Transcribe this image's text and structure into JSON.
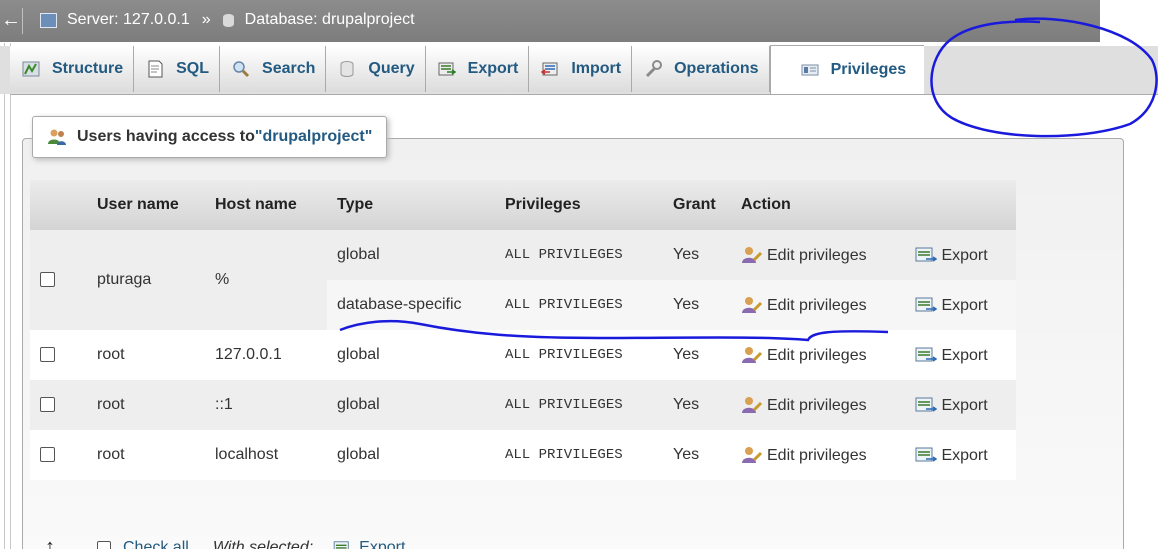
{
  "topbar": {
    "back_glyph": "←",
    "server_label": "Server: 127.0.0.1",
    "separator": "»",
    "database_label": "Database: drupalproject"
  },
  "tabs": [
    {
      "label": "Structure",
      "icon": "structure-icon"
    },
    {
      "label": "SQL",
      "icon": "sql-icon"
    },
    {
      "label": "Search",
      "icon": "search-icon"
    },
    {
      "label": "Query",
      "icon": "query-icon"
    },
    {
      "label": "Export",
      "icon": "export-icon"
    },
    {
      "label": "Import",
      "icon": "import-icon"
    },
    {
      "label": "Operations",
      "icon": "wrench-icon"
    },
    {
      "label": "Privileges",
      "icon": "privileges-icon",
      "active": true
    }
  ],
  "section": {
    "title_prefix": "Users having access to ",
    "title_db": "\"drupalproject\""
  },
  "table": {
    "headers": [
      "User name",
      "Host name",
      "Type",
      "Privileges",
      "Grant",
      "Action"
    ],
    "rows": [
      {
        "user": "pturaga",
        "host": "%",
        "entries": [
          {
            "type": "global",
            "privileges": "ALL PRIVILEGES",
            "grant": "Yes"
          },
          {
            "type": "database-specific",
            "privileges": "ALL PRIVILEGES",
            "grant": "Yes"
          }
        ]
      },
      {
        "user": "root",
        "host": "127.0.0.1",
        "entries": [
          {
            "type": "global",
            "privileges": "ALL PRIVILEGES",
            "grant": "Yes"
          }
        ]
      },
      {
        "user": "root",
        "host": "::1",
        "entries": [
          {
            "type": "global",
            "privileges": "ALL PRIVILEGES",
            "grant": "Yes"
          }
        ]
      },
      {
        "user": "root",
        "host": "localhost",
        "entries": [
          {
            "type": "global",
            "privileges": "ALL PRIVILEGES",
            "grant": "Yes"
          }
        ]
      }
    ],
    "edit_label": "Edit privileges",
    "export_label": "Export"
  },
  "footer": {
    "arrow": "↑",
    "check_all": "Check all",
    "with_selected": "With selected:",
    "export": "Export"
  },
  "colors": {
    "link": "#235a81",
    "annotation": "#1a1adc"
  }
}
